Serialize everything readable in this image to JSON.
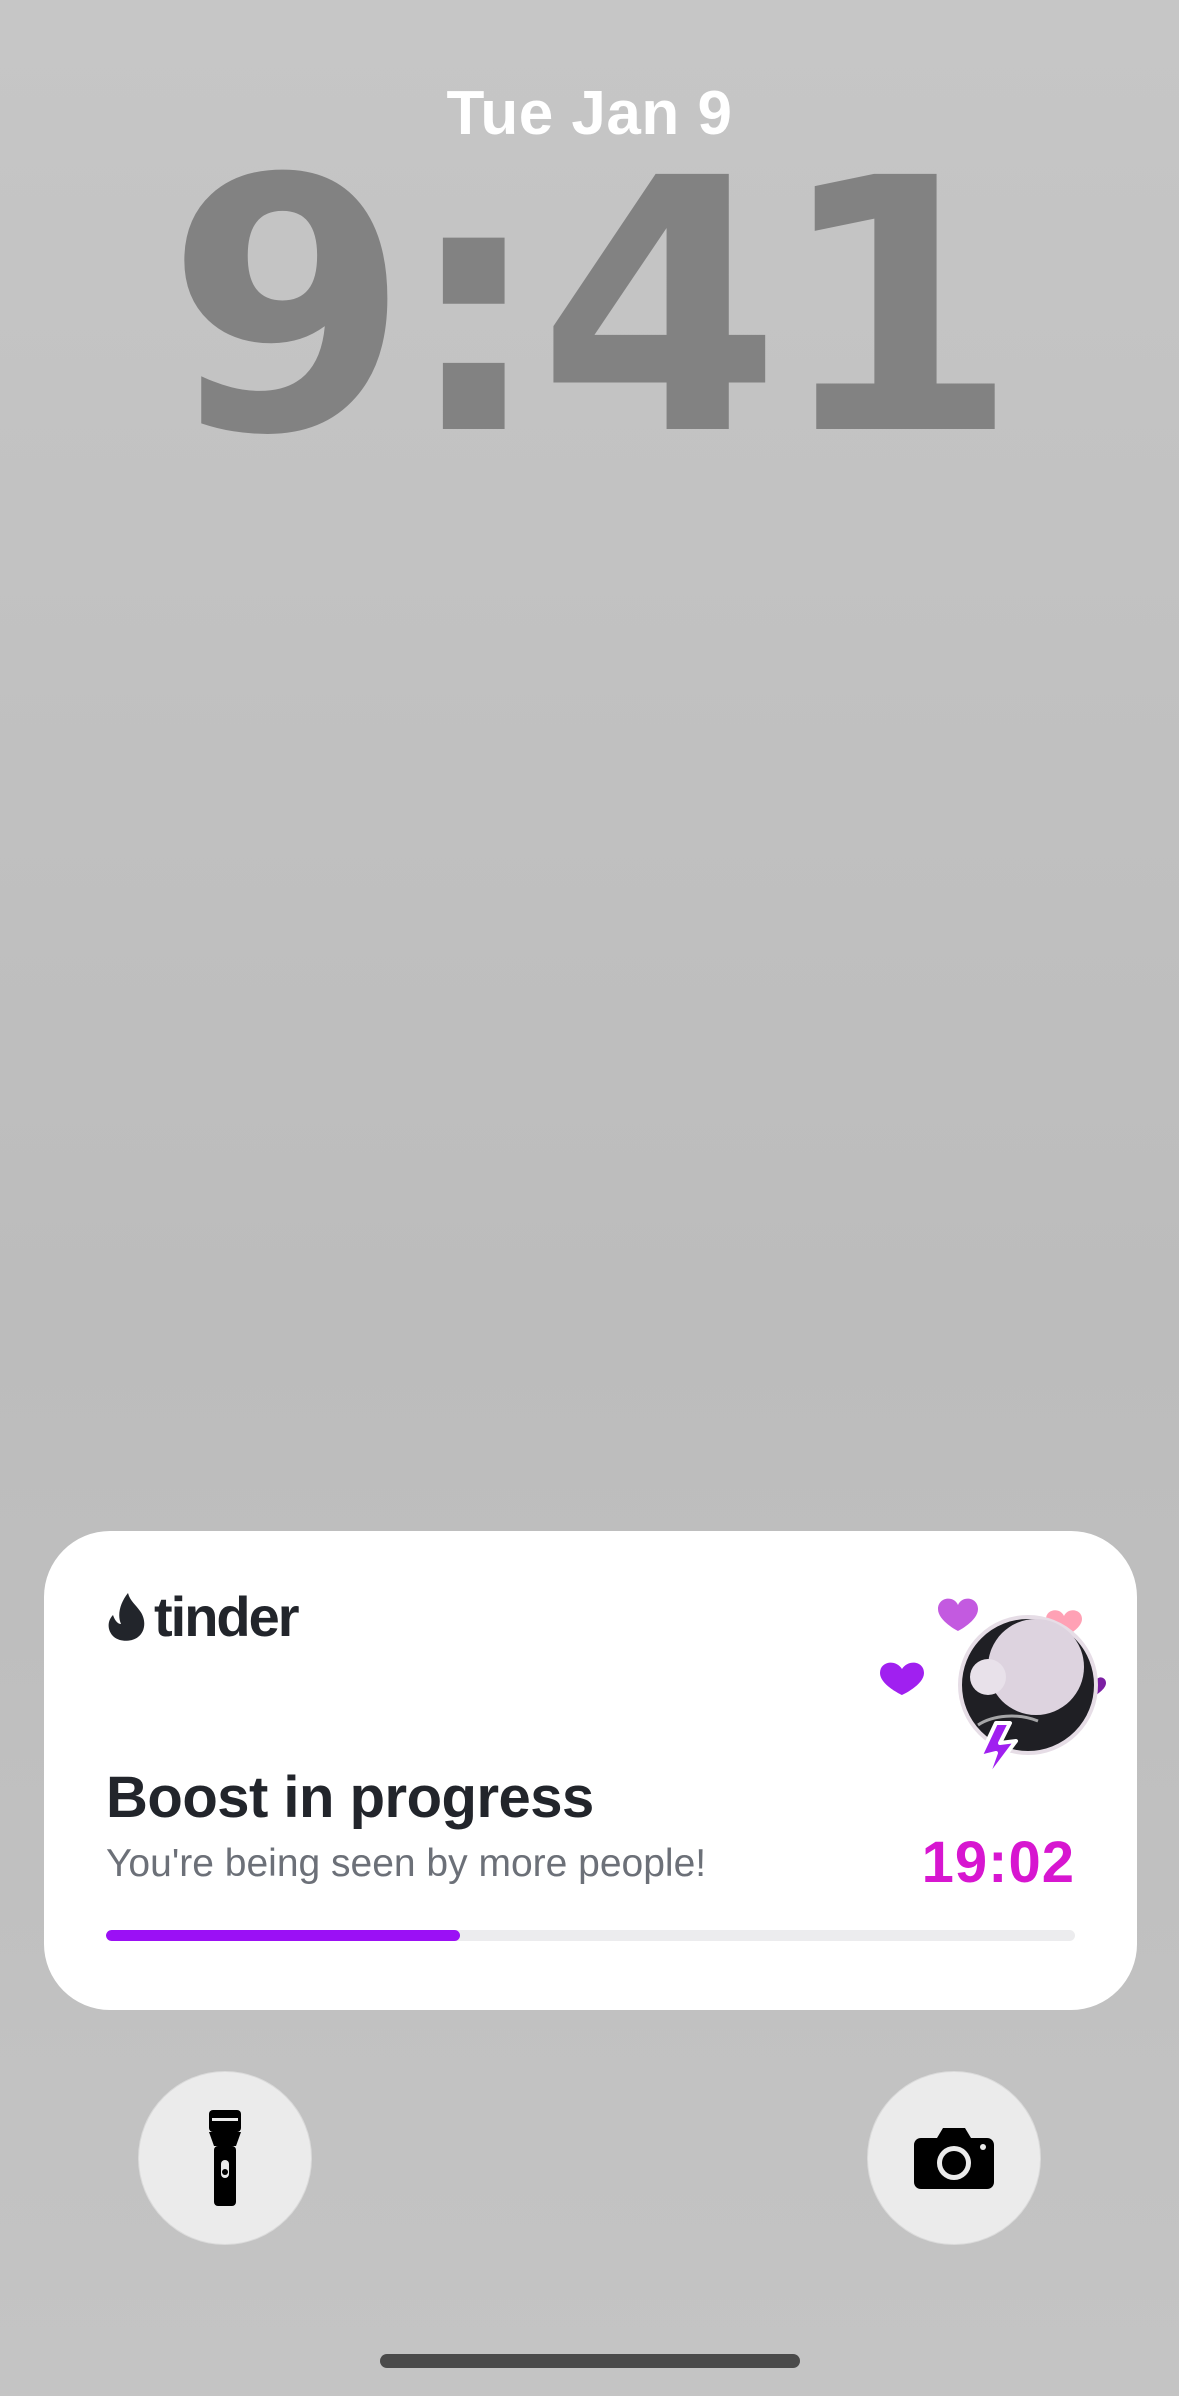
{
  "lock_screen": {
    "date": "Tue Jan 9",
    "time": "9:41"
  },
  "live_activity": {
    "app_name": "tinder",
    "title": "Boost in progress",
    "subtitle": "You're being seen by more people!",
    "timer": "19:02",
    "progress_fraction": 0.365,
    "colors": {
      "timer": "#d716d0",
      "progress": "#9b10f5",
      "hearts": [
        "#c35ae0",
        "#ffa1b5",
        "#a020f0",
        "#7b1fa2"
      ],
      "bolt": "#a020f0"
    }
  },
  "quick_actions": {
    "left_icon": "flashlight-icon",
    "right_icon": "camera-icon"
  }
}
